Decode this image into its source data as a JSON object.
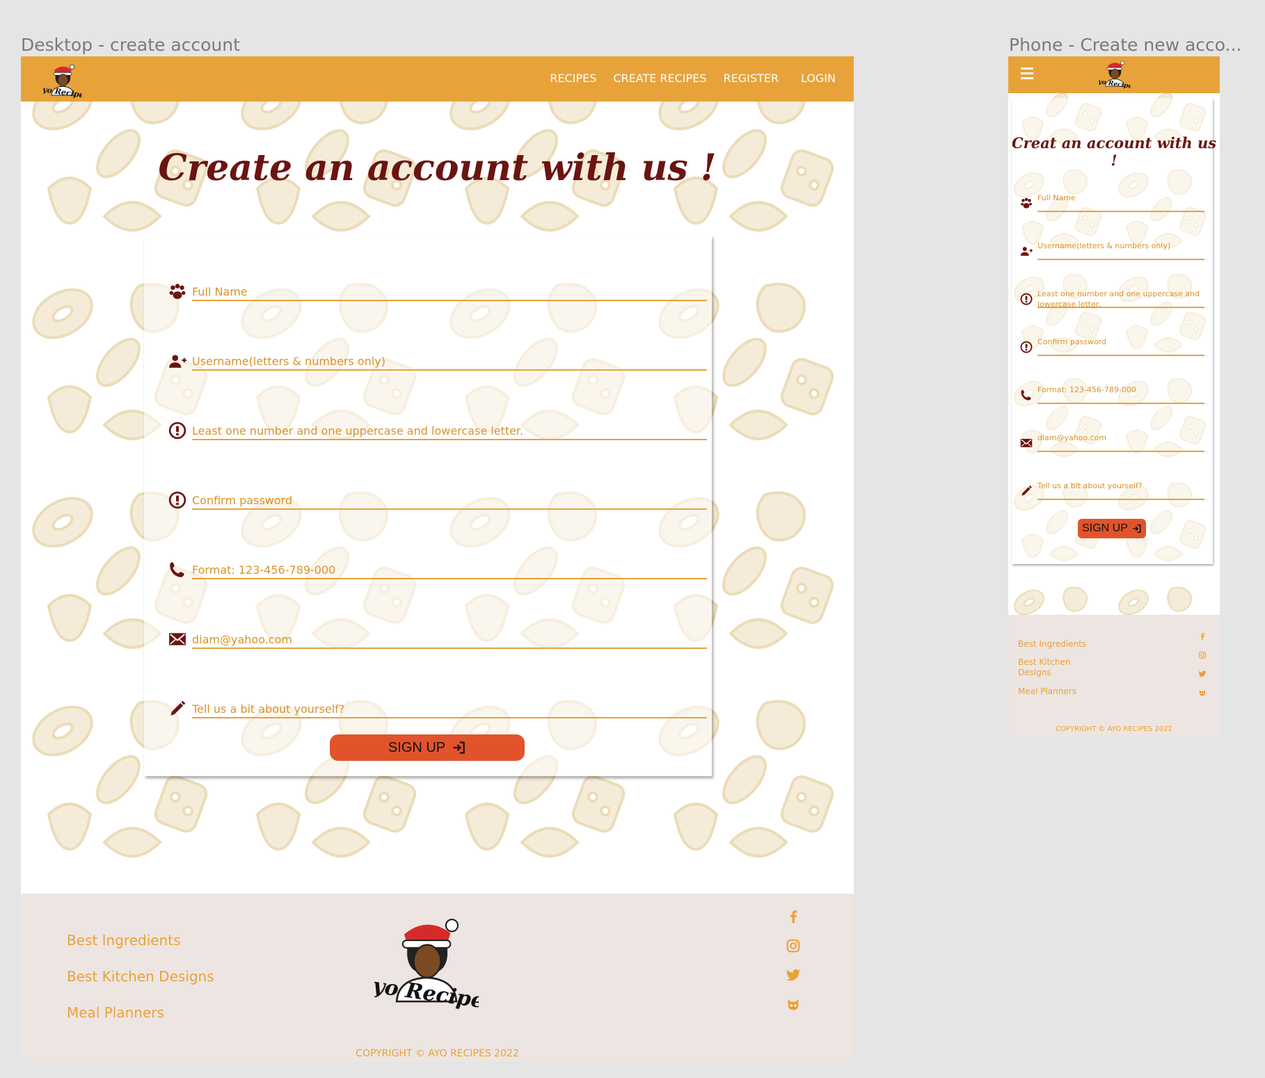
{
  "desktop": {
    "frame_label": "Desktop - create account",
    "nav": {
      "links": [
        "RECIPES",
        "CREATE RECIPES",
        "REGISTER",
        "LOGIN"
      ]
    },
    "title": "Create an account with us !",
    "fields": [
      {
        "icon": "users-icon",
        "placeholder": "Full Name"
      },
      {
        "icon": "user-plus-icon",
        "placeholder": "Username(letters & numbers only)"
      },
      {
        "icon": "exclamation-circle-icon",
        "placeholder": "Least one number and one uppercase and lowercase letter."
      },
      {
        "icon": "exclamation-circle-icon",
        "placeholder": "Confirm password"
      },
      {
        "icon": "phone-icon",
        "placeholder": "Format: 123-456-789-000"
      },
      {
        "icon": "envelope-icon",
        "placeholder": "diam@yahoo.com"
      },
      {
        "icon": "pencil-icon",
        "placeholder": "Tell us a bit about yourself?"
      }
    ],
    "signup_label": "SIGN UP",
    "footer": {
      "links": [
        "Best Ingredients",
        "Best Kitchen Designs",
        "Meal Planners"
      ],
      "logo_text": "Ayo Recipes",
      "social": [
        "facebook-icon",
        "instagram-icon",
        "twitter-icon",
        "github-icon"
      ],
      "copyright": "COPYRIGHT © AYO RECIPES 2022"
    }
  },
  "phone": {
    "frame_label": "Phone - Create new acco...",
    "title": "Creat an account with us !",
    "fields": [
      {
        "icon": "users-icon",
        "placeholder": "Full Name"
      },
      {
        "icon": "user-plus-icon",
        "placeholder": "Username(letters & numbers only)"
      },
      {
        "icon": "exclamation-circle-icon",
        "placeholder": "Least one number and one uppercase and lowercase letter."
      },
      {
        "icon": "exclamation-circle-icon",
        "placeholder": "Confirm password"
      },
      {
        "icon": "phone-icon",
        "placeholder": "Format: 123-456-789-000"
      },
      {
        "icon": "envelope-icon",
        "placeholder": "diam@yahoo.com"
      },
      {
        "icon": "pencil-icon",
        "placeholder": "Tell us a bit about yourself?"
      }
    ],
    "signup_label": "SIGN UP",
    "footer": {
      "links": [
        "Best Ingredients",
        "Best Kitchen Designs",
        "Meal Planners"
      ],
      "social": [
        "facebook-icon",
        "instagram-icon",
        "twitter-icon",
        "github-icon"
      ],
      "copyright": "COPYRIGHT © AYO RECIPES 2022"
    }
  },
  "colors": {
    "nav": "#e8a23a",
    "accent_text": "#d9922a",
    "title": "#6b1411",
    "button": "#e2532c",
    "footer_bg": "#ede5e1",
    "pattern": "#f3ead5"
  }
}
